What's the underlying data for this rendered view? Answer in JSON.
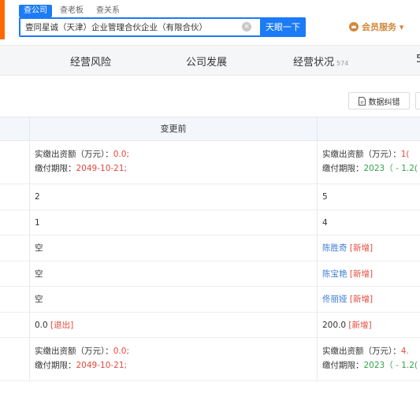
{
  "search": {
    "tabs": [
      "查公司",
      "查老板",
      "查关系"
    ],
    "query": "壹同星诚（天津）企业管理合伙企业（有限合伙）",
    "button": "天眼一下"
  },
  "member": {
    "label": "会员服务 ▾"
  },
  "nav": {
    "items": [
      {
        "label": "经营风险",
        "count": ""
      },
      {
        "label": "公司发展",
        "count": ""
      },
      {
        "label": "经营状况",
        "count": "574"
      },
      {
        "label": "5",
        "count": ""
      }
    ]
  },
  "toolbar": {
    "feedback_label": "数据纠错"
  },
  "table": {
    "header_before": "变更前",
    "rows": [
      {
        "before_l1_label": "实缴出资额（万元）：",
        "before_l1_value": "0.0;",
        "before_l2_label": "缴付期限：",
        "before_l2_value": "2049-10-21;",
        "after_l1_label": "实缴出资额（万元）：",
        "after_l1_value": "1(",
        "after_l2_label": "缴付期限：",
        "after_l2_value": "2023",
        "after_l2_extra": "（ - 1.2("
      },
      {
        "before": "2",
        "after": "5"
      },
      {
        "before": "1",
        "after": "4"
      },
      {
        "before": "空",
        "after_name": "陈胜奇",
        "after_tag": "[新增]"
      },
      {
        "before": "空",
        "after_name": "陈宝艳",
        "after_tag": "[新增]"
      },
      {
        "before": "空",
        "after_name": "佟丽娅",
        "after_tag": "[新增]"
      },
      {
        "before_value": "0.0",
        "before_tag": "[退出]",
        "after_value": "200.0",
        "after_tag": "[新增]"
      },
      {
        "before_l1_label": "实缴出资额（万元）：",
        "before_l1_value": "0.0;",
        "before_l2_label": "缴付期限：",
        "before_l2_value": "2049-10-21;",
        "after_l1_label": "实缴出资额（万元）：",
        "after_l1_value": "4.",
        "after_l2_label": "缴付期限：",
        "after_l2_value": "2023",
        "after_l2_extra": "（ - 1.2("
      }
    ]
  },
  "colors": {
    "accent": "#1c7bf6",
    "brand": "#ff6a00",
    "red": "#e5483e",
    "green": "#33a34a",
    "link": "#3d7ad6",
    "member": "#d1873b"
  }
}
